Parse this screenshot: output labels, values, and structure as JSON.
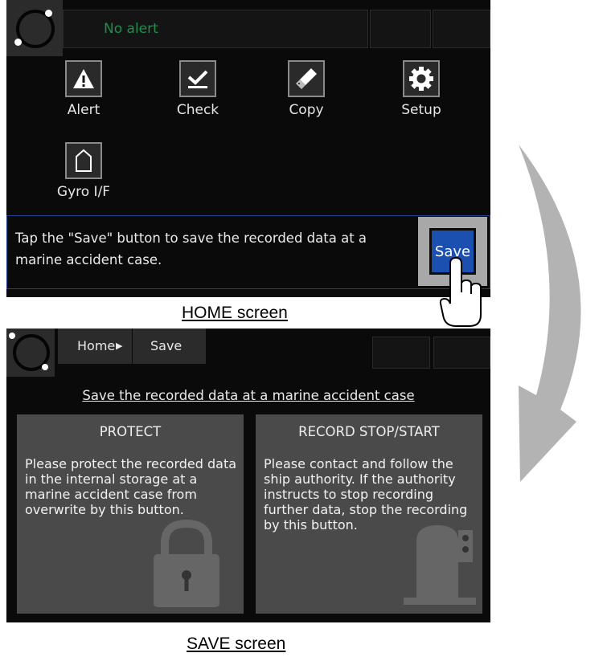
{
  "home": {
    "status_text": "No alert",
    "apps": [
      {
        "label": "Alert",
        "icon": "alert-icon"
      },
      {
        "label": "Check",
        "icon": "check-icon"
      },
      {
        "label": "Copy",
        "icon": "usb-drive-icon"
      },
      {
        "label": "Setup",
        "icon": "gear-icon"
      },
      {
        "label": "Gyro I/F",
        "icon": "ship-bow-icon"
      }
    ],
    "message": "Tap the \"Save\" button to save the recorded data at a marine accident case.",
    "save_button_label": "Save",
    "caption": "HOME screen"
  },
  "save": {
    "breadcrumb": {
      "home": "Home",
      "current": "Save"
    },
    "title": "Save the recorded data at a marine accident case",
    "panels": [
      {
        "title": "PROTECT",
        "text": "Please protect the recorded data in the internal storage at a marine accident case from overwrite by this button.",
        "icon": "padlock-icon"
      },
      {
        "title": "RECORD STOP/START",
        "text": "Please contact and follow the ship authority. If the authority instructs to stop recording further data, stop the recording by this button.",
        "icon": "recorder-icon"
      }
    ],
    "caption": "SAVE screen"
  },
  "colors": {
    "save_button": "#1b4fb0",
    "status_text": "#1f8f4e",
    "panel": "#4a4a4a",
    "arrow": "#b3b3b3"
  }
}
